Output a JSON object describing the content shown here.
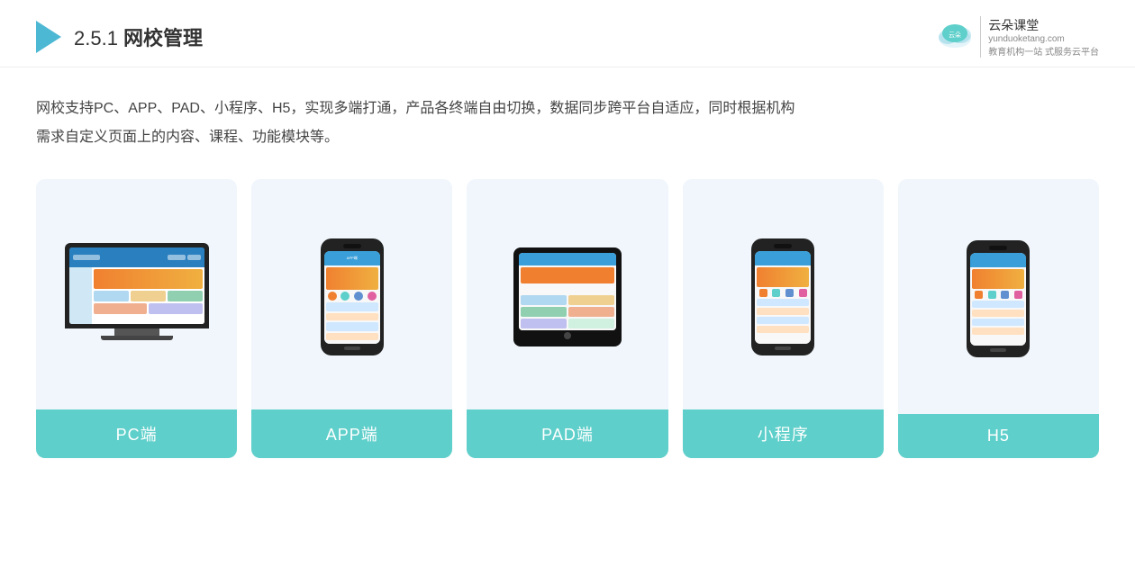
{
  "header": {
    "title_prefix": "2.5.1 ",
    "title_main": "网校管理",
    "brand_url": "yunduoketang.com",
    "brand_tagline1": "教育机构一站",
    "brand_tagline2": "式服务云平台"
  },
  "description": {
    "text": "网校支持PC、APP、PAD、小程序、H5，实现多端打通，产品各终端自由切换，数据同步跨平台自适应，同时根据机构需求自定义页面上的内容、课程、功能模块等。"
  },
  "devices": [
    {
      "id": "pc",
      "label": "PC端"
    },
    {
      "id": "app",
      "label": "APP端"
    },
    {
      "id": "pad",
      "label": "PAD端"
    },
    {
      "id": "miniprogram",
      "label": "小程序"
    },
    {
      "id": "h5",
      "label": "H5"
    }
  ],
  "colors": {
    "accent": "#5ecfca",
    "header_bg": "#fff",
    "card_bg": "#f0f6fb",
    "label_bar": "#5ecfca"
  }
}
